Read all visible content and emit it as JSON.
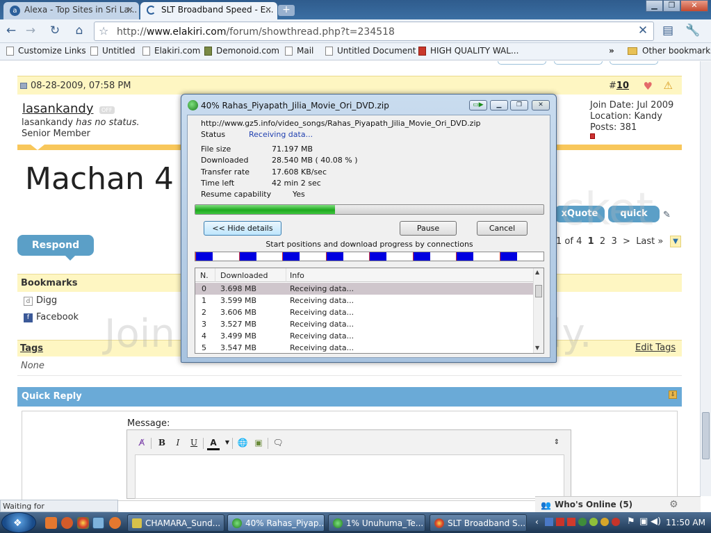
{
  "browser": {
    "tabs": [
      {
        "label": "Alexa - Top Sites in Sri La..."
      },
      {
        "label": "SLT Broadband Speed - E..."
      }
    ],
    "url_prefix": "http://",
    "url_domain": "www.elakiri.com",
    "url_path": "/forum/showthread.php?t=234518",
    "bookmarks": [
      "Customize Links",
      "Untitled",
      "Elakiri.com",
      "Demonoid.com",
      "Mail",
      "Untitled Document",
      "HIGH QUALITY WAL..."
    ],
    "other_bookmarks": "Other bookmarks",
    "overflow": "»"
  },
  "post": {
    "date": "08-28-2009, 07:58 PM",
    "number_prefix": "#",
    "number": "10",
    "username": "lasankandy",
    "status_user": "lasankandy",
    "status_text": "has no status.",
    "rank": "Senior Member",
    "join_date": "Join Date: Jul 2009",
    "location": "Location: Kandy",
    "posts": "Posts: 381",
    "offline": "OFF",
    "body": "Machan 4"
  },
  "actions": {
    "xquote": "xQuote",
    "quick_reply": "quick reply",
    "respond": "Respond"
  },
  "pagination": {
    "page_of": "1 of 4",
    "pages": [
      "1",
      "2",
      "3"
    ],
    "next": ">",
    "last": "Last »"
  },
  "bookmarks_section": {
    "title": "Bookmarks",
    "items": [
      "Digg",
      "Facebook"
    ]
  },
  "tags": {
    "title": "Tags",
    "edit": "Edit Tags",
    "none": "None"
  },
  "quick_reply": {
    "title": "Quick Reply",
    "message_label": "Message:"
  },
  "status_bar": {
    "loading": "Waiting for www.elakiri.com...",
    "whos_online": "Who's Online (5)"
  },
  "download": {
    "title": "40% Rahas_Piyapath_Jilia_Movie_Ori_DVD.zip",
    "url": "http://www.gz5.info/video_songs/Rahas_Piyapath_Jilia_Movie_Ori_DVD.zip",
    "status_label": "Status",
    "status_value": "Receiving data...",
    "file_size_label": "File size",
    "file_size": "71.197  MB",
    "downloaded_label": "Downloaded",
    "downloaded": "28.540  MB  ( 40.08 % )",
    "transfer_label": "Transfer rate",
    "transfer": "17.608  KB/sec",
    "time_left_label": "Time left",
    "time_left": "42 min 2 sec",
    "resume_label": "Resume capability",
    "resume": "Yes",
    "progress_fraction": 0.4008,
    "hide_details": "<< Hide details",
    "pause": "Pause",
    "cancel": "Cancel",
    "connections_label": "Start positions and download progress by connections",
    "list_headers": [
      "N.",
      "Downloaded",
      "Info"
    ],
    "connections": [
      {
        "n": "0",
        "downloaded": "3.698  MB",
        "info": "Receiving data..."
      },
      {
        "n": "1",
        "downloaded": "3.599  MB",
        "info": "Receiving data..."
      },
      {
        "n": "2",
        "downloaded": "3.606  MB",
        "info": "Receiving data..."
      },
      {
        "n": "3",
        "downloaded": "3.527  MB",
        "info": "Receiving data..."
      },
      {
        "n": "4",
        "downloaded": "3.499  MB",
        "info": "Receiving data..."
      },
      {
        "n": "5",
        "downloaded": "3.547  MB",
        "info": "Receiving data..."
      }
    ]
  },
  "watermark": {
    "brand": "photobucket",
    "slogan": "Join free. Share privately."
  },
  "taskbar": {
    "tasks": [
      "CHAMARA_Sund...",
      "40% Rahas_Piyap...",
      "1% Unuhuma_Te...",
      "SLT Broadband S..."
    ],
    "time": "11:50 AM"
  },
  "colors": {
    "accent_blue": "#5b9fc7",
    "post_header": "#fef6c2",
    "gold_bar": "#f8c75b",
    "progress_green": "#1fa81f",
    "connection_blue": "#0000e0"
  }
}
